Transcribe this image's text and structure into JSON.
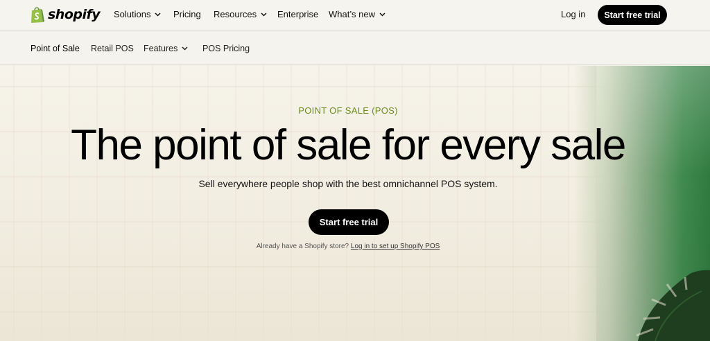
{
  "brand": {
    "name": "shopify",
    "logo_icon": "shopify-bag-icon",
    "green": "#95bf47"
  },
  "topnav": {
    "items": [
      {
        "label": "Solutions",
        "has_dropdown": true
      },
      {
        "label": "Pricing",
        "has_dropdown": false
      },
      {
        "label": "Resources",
        "has_dropdown": true
      },
      {
        "label": "Enterprise",
        "has_dropdown": false
      },
      {
        "label": "What’s new",
        "has_dropdown": true
      }
    ],
    "login_label": "Log in",
    "cta_label": "Start free trial"
  },
  "subnav": {
    "items": [
      {
        "label": "Point of Sale",
        "active": true
      },
      {
        "label": "Retail POS"
      },
      {
        "label": "Features",
        "has_dropdown": true
      },
      {
        "label": "POS Pricing"
      }
    ]
  },
  "hero": {
    "eyebrow": "POINT OF SALE (POS)",
    "headline": "The point of sale for every sale",
    "subhead": "Sell everywhere people shop with the best omnichannel POS system.",
    "cta_label": "Start free trial",
    "existing_prefix": "Already have a Shopify store?",
    "existing_link": "Log in to set up Shopify POS",
    "eyebrow_color": "#6a8c1e"
  }
}
